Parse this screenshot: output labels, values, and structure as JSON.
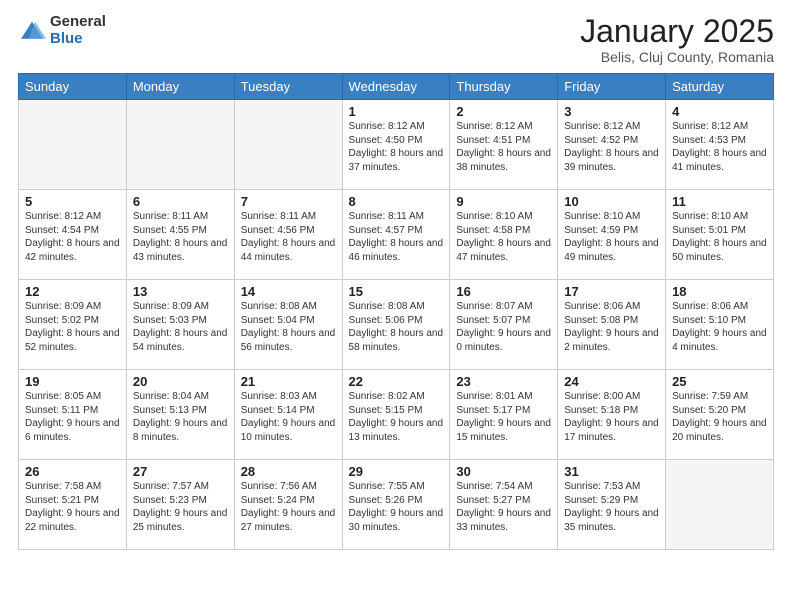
{
  "logo": {
    "general": "General",
    "blue": "Blue"
  },
  "header": {
    "title": "January 2025",
    "subtitle": "Belis, Cluj County, Romania"
  },
  "days": [
    "Sunday",
    "Monday",
    "Tuesday",
    "Wednesday",
    "Thursday",
    "Friday",
    "Saturday"
  ],
  "weeks": [
    [
      {
        "day": "",
        "sunrise": "",
        "sunset": "",
        "daylight": ""
      },
      {
        "day": "",
        "sunrise": "",
        "sunset": "",
        "daylight": ""
      },
      {
        "day": "",
        "sunrise": "",
        "sunset": "",
        "daylight": ""
      },
      {
        "day": "1",
        "sunrise": "Sunrise: 8:12 AM",
        "sunset": "Sunset: 4:50 PM",
        "daylight": "Daylight: 8 hours and 37 minutes."
      },
      {
        "day": "2",
        "sunrise": "Sunrise: 8:12 AM",
        "sunset": "Sunset: 4:51 PM",
        "daylight": "Daylight: 8 hours and 38 minutes."
      },
      {
        "day": "3",
        "sunrise": "Sunrise: 8:12 AM",
        "sunset": "Sunset: 4:52 PM",
        "daylight": "Daylight: 8 hours and 39 minutes."
      },
      {
        "day": "4",
        "sunrise": "Sunrise: 8:12 AM",
        "sunset": "Sunset: 4:53 PM",
        "daylight": "Daylight: 8 hours and 41 minutes."
      }
    ],
    [
      {
        "day": "5",
        "sunrise": "Sunrise: 8:12 AM",
        "sunset": "Sunset: 4:54 PM",
        "daylight": "Daylight: 8 hours and 42 minutes."
      },
      {
        "day": "6",
        "sunrise": "Sunrise: 8:11 AM",
        "sunset": "Sunset: 4:55 PM",
        "daylight": "Daylight: 8 hours and 43 minutes."
      },
      {
        "day": "7",
        "sunrise": "Sunrise: 8:11 AM",
        "sunset": "Sunset: 4:56 PM",
        "daylight": "Daylight: 8 hours and 44 minutes."
      },
      {
        "day": "8",
        "sunrise": "Sunrise: 8:11 AM",
        "sunset": "Sunset: 4:57 PM",
        "daylight": "Daylight: 8 hours and 46 minutes."
      },
      {
        "day": "9",
        "sunrise": "Sunrise: 8:10 AM",
        "sunset": "Sunset: 4:58 PM",
        "daylight": "Daylight: 8 hours and 47 minutes."
      },
      {
        "day": "10",
        "sunrise": "Sunrise: 8:10 AM",
        "sunset": "Sunset: 4:59 PM",
        "daylight": "Daylight: 8 hours and 49 minutes."
      },
      {
        "day": "11",
        "sunrise": "Sunrise: 8:10 AM",
        "sunset": "Sunset: 5:01 PM",
        "daylight": "Daylight: 8 hours and 50 minutes."
      }
    ],
    [
      {
        "day": "12",
        "sunrise": "Sunrise: 8:09 AM",
        "sunset": "Sunset: 5:02 PM",
        "daylight": "Daylight: 8 hours and 52 minutes."
      },
      {
        "day": "13",
        "sunrise": "Sunrise: 8:09 AM",
        "sunset": "Sunset: 5:03 PM",
        "daylight": "Daylight: 8 hours and 54 minutes."
      },
      {
        "day": "14",
        "sunrise": "Sunrise: 8:08 AM",
        "sunset": "Sunset: 5:04 PM",
        "daylight": "Daylight: 8 hours and 56 minutes."
      },
      {
        "day": "15",
        "sunrise": "Sunrise: 8:08 AM",
        "sunset": "Sunset: 5:06 PM",
        "daylight": "Daylight: 8 hours and 58 minutes."
      },
      {
        "day": "16",
        "sunrise": "Sunrise: 8:07 AM",
        "sunset": "Sunset: 5:07 PM",
        "daylight": "Daylight: 9 hours and 0 minutes."
      },
      {
        "day": "17",
        "sunrise": "Sunrise: 8:06 AM",
        "sunset": "Sunset: 5:08 PM",
        "daylight": "Daylight: 9 hours and 2 minutes."
      },
      {
        "day": "18",
        "sunrise": "Sunrise: 8:06 AM",
        "sunset": "Sunset: 5:10 PM",
        "daylight": "Daylight: 9 hours and 4 minutes."
      }
    ],
    [
      {
        "day": "19",
        "sunrise": "Sunrise: 8:05 AM",
        "sunset": "Sunset: 5:11 PM",
        "daylight": "Daylight: 9 hours and 6 minutes."
      },
      {
        "day": "20",
        "sunrise": "Sunrise: 8:04 AM",
        "sunset": "Sunset: 5:13 PM",
        "daylight": "Daylight: 9 hours and 8 minutes."
      },
      {
        "day": "21",
        "sunrise": "Sunrise: 8:03 AM",
        "sunset": "Sunset: 5:14 PM",
        "daylight": "Daylight: 9 hours and 10 minutes."
      },
      {
        "day": "22",
        "sunrise": "Sunrise: 8:02 AM",
        "sunset": "Sunset: 5:15 PM",
        "daylight": "Daylight: 9 hours and 13 minutes."
      },
      {
        "day": "23",
        "sunrise": "Sunrise: 8:01 AM",
        "sunset": "Sunset: 5:17 PM",
        "daylight": "Daylight: 9 hours and 15 minutes."
      },
      {
        "day": "24",
        "sunrise": "Sunrise: 8:00 AM",
        "sunset": "Sunset: 5:18 PM",
        "daylight": "Daylight: 9 hours and 17 minutes."
      },
      {
        "day": "25",
        "sunrise": "Sunrise: 7:59 AM",
        "sunset": "Sunset: 5:20 PM",
        "daylight": "Daylight: 9 hours and 20 minutes."
      }
    ],
    [
      {
        "day": "26",
        "sunrise": "Sunrise: 7:58 AM",
        "sunset": "Sunset: 5:21 PM",
        "daylight": "Daylight: 9 hours and 22 minutes."
      },
      {
        "day": "27",
        "sunrise": "Sunrise: 7:57 AM",
        "sunset": "Sunset: 5:23 PM",
        "daylight": "Daylight: 9 hours and 25 minutes."
      },
      {
        "day": "28",
        "sunrise": "Sunrise: 7:56 AM",
        "sunset": "Sunset: 5:24 PM",
        "daylight": "Daylight: 9 hours and 27 minutes."
      },
      {
        "day": "29",
        "sunrise": "Sunrise: 7:55 AM",
        "sunset": "Sunset: 5:26 PM",
        "daylight": "Daylight: 9 hours and 30 minutes."
      },
      {
        "day": "30",
        "sunrise": "Sunrise: 7:54 AM",
        "sunset": "Sunset: 5:27 PM",
        "daylight": "Daylight: 9 hours and 33 minutes."
      },
      {
        "day": "31",
        "sunrise": "Sunrise: 7:53 AM",
        "sunset": "Sunset: 5:29 PM",
        "daylight": "Daylight: 9 hours and 35 minutes."
      },
      {
        "day": "",
        "sunrise": "",
        "sunset": "",
        "daylight": ""
      }
    ]
  ]
}
